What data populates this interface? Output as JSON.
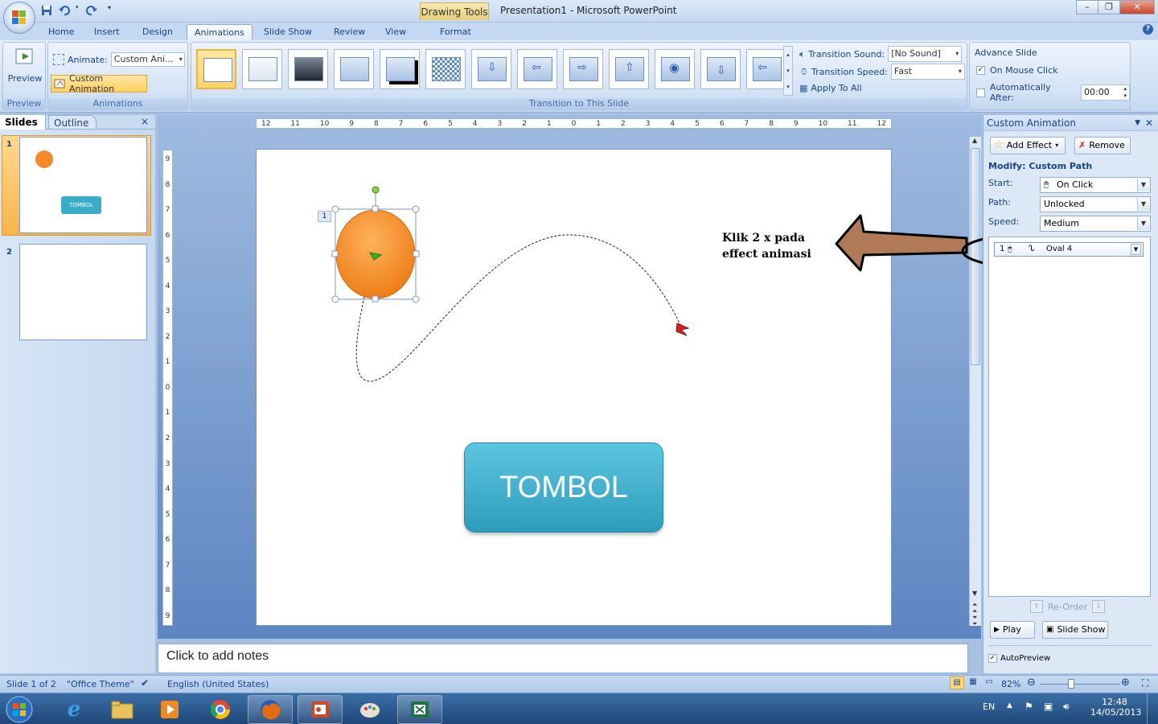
{
  "window": {
    "contextual_tab": "Drawing Tools",
    "title": "Presentation1 - Microsoft PowerPoint"
  },
  "tabs": [
    "Home",
    "Insert",
    "Design",
    "Animations",
    "Slide Show",
    "Review",
    "View",
    "Format"
  ],
  "ribbon": {
    "preview": {
      "button": "Preview",
      "group": "Preview"
    },
    "animations": {
      "animate_label": "Animate:",
      "animate_value": "Custom Ani...",
      "custom_animation": "Custom Animation",
      "group": "Animations"
    },
    "transition": {
      "group": "Transition to This Slide",
      "sound_label": "Transition Sound:",
      "sound_value": "[No Sound]",
      "speed_label": "Transition Speed:",
      "speed_value": "Fast",
      "apply_all": "Apply To All"
    },
    "advance": {
      "title": "Advance Slide",
      "on_mouse_click": "On Mouse Click",
      "on_mouse_click_checked": true,
      "automatically_after": "Automatically After:",
      "automatically_after_checked": false,
      "time": "00:00"
    }
  },
  "slides_panel": {
    "tabs": [
      "Slides",
      "Outline"
    ],
    "thumbs": [
      {
        "num": "1",
        "button_text": "TOMBOL"
      },
      {
        "num": "2"
      }
    ]
  },
  "slide": {
    "anim_tag": "1",
    "button_text": "TOMBOL",
    "annotation_line1": "Klik 2 x pada",
    "annotation_line2": "effect animasi"
  },
  "ruler": {
    "h_ticks": [
      "12",
      "11",
      "10",
      "9",
      "8",
      "7",
      "6",
      "5",
      "4",
      "3",
      "2",
      "1",
      "0",
      "1",
      "2",
      "3",
      "4",
      "5",
      "6",
      "7",
      "8",
      "9",
      "10",
      "11",
      "12"
    ],
    "v_ticks": [
      "9",
      "8",
      "7",
      "6",
      "5",
      "4",
      "3",
      "2",
      "1",
      "0",
      "1",
      "2",
      "3",
      "4",
      "5",
      "6",
      "7",
      "8",
      "9"
    ]
  },
  "notes_placeholder": "Click to add notes",
  "anim_pane": {
    "title": "Custom Animation",
    "add_effect": "Add Effect",
    "remove": "Remove",
    "modify": "Modify: Custom Path",
    "start_label": "Start:",
    "start_value": "On Click",
    "path_label": "Path:",
    "path_value": "Unlocked",
    "speed_label": "Speed:",
    "speed_value": "Medium",
    "item_num": "1",
    "item_name": "Oval 4",
    "reorder": "Re-Order",
    "play": "Play",
    "slideshow": "Slide Show",
    "autopreview": "AutoPreview",
    "autopreview_checked": true
  },
  "status": {
    "slide": "Slide 1 of 2",
    "theme": "\"Office Theme\"",
    "language": "English (United States)",
    "zoom": "82%"
  },
  "taskbar": {
    "lang": "EN",
    "time": "12:48",
    "date": "14/05/2013"
  },
  "colors": {
    "orange_oval": "#f7941d",
    "tombol_button": "#3aabc8",
    "annotation_arrow": "#b07a56"
  }
}
